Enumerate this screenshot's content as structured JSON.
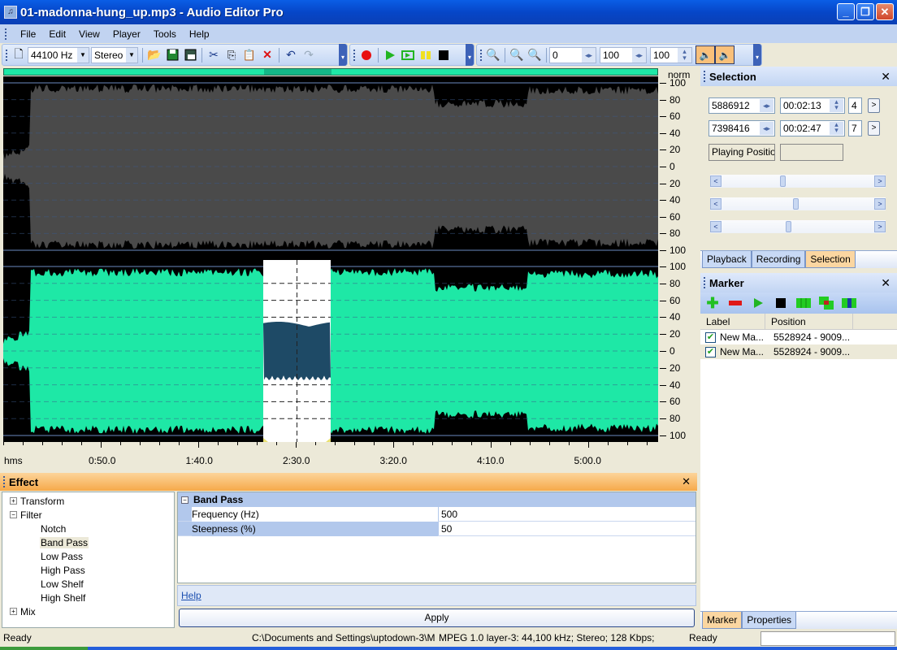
{
  "window": {
    "title": "01-madonna-hung_up.mp3 - Audio Editor Pro",
    "buttons": [
      "minimize",
      "restore",
      "close"
    ]
  },
  "menu": [
    "File",
    "Edit",
    "View",
    "Player",
    "Tools",
    "Help"
  ],
  "toolbar": {
    "sample_rate": "44100 Hz",
    "channels": "Stereo",
    "zoom_h": "0",
    "zoom_v": "100",
    "volume": "100",
    "icons": [
      "new-file-icon",
      "open-folder-icon",
      "save-icon",
      "save-as-icon",
      "cut-icon",
      "copy-icon",
      "paste-icon",
      "delete-icon",
      "undo-icon",
      "redo-icon",
      "record-icon",
      "play-icon",
      "play-loop-icon",
      "pause-icon",
      "stop-icon",
      "zoom-all-icon",
      "zoom-in-icon",
      "zoom-out-icon",
      "left-channel-icon",
      "right-channel-icon"
    ]
  },
  "waveform": {
    "scale_label": "norm",
    "scale_ticks": [
      "100",
      "80",
      "60",
      "40",
      "20",
      "0",
      "20",
      "40",
      "60",
      "80",
      "100"
    ],
    "time_unit": "hms",
    "time_ticks": [
      "0:50.0",
      "1:40.0",
      "2:30.0",
      "3:20.0",
      "4:10.0",
      "5:00.0"
    ],
    "selection_fraction": [
      0.397,
      0.5
    ],
    "colors": {
      "channel1": "#4a4a4a",
      "channel2": "#1ee8a6",
      "selected": "#1e4a66",
      "background": "#000000"
    }
  },
  "effect": {
    "title": "Effect",
    "tree": [
      {
        "label": "Transform",
        "type": "group",
        "expanded": false
      },
      {
        "label": "Filter",
        "type": "group",
        "expanded": true
      },
      {
        "label": "Notch",
        "type": "leaf"
      },
      {
        "label": "Band Pass",
        "type": "leaf",
        "selected": true
      },
      {
        "label": "Low Pass",
        "type": "leaf"
      },
      {
        "label": "High Pass",
        "type": "leaf"
      },
      {
        "label": "Low Shelf",
        "type": "leaf"
      },
      {
        "label": "High Shelf",
        "type": "leaf"
      },
      {
        "label": "Mix",
        "type": "group",
        "expanded": false
      }
    ],
    "properties": {
      "category": "Band Pass",
      "rows": [
        {
          "name": "Frequency (Hz)",
          "value": "500"
        },
        {
          "name": "Steepness (%)",
          "value": "50"
        }
      ]
    },
    "help_link": "Help",
    "apply_label": "Apply"
  },
  "selection_panel": {
    "title": "Selection",
    "start_sample": "5886912",
    "start_time": "00:02:13",
    "start_num": "4",
    "end_sample": "7398416",
    "end_time": "00:02:47",
    "end_num": "7",
    "playing_position_label": "Playing Positio",
    "playing_position_value": "",
    "sliders": [
      0.38,
      0.47,
      0.42
    ],
    "tabs": [
      "Playback",
      "Recording",
      "Selection"
    ],
    "active_tab": 2
  },
  "marker_panel": {
    "title": "Marker",
    "columns": [
      "Label",
      "Position"
    ],
    "rows": [
      {
        "checked": true,
        "label": "New Ma...",
        "position": "5528924 - 9009..."
      },
      {
        "checked": true,
        "label": "New Ma...",
        "position": "5528924 - 9009..."
      }
    ],
    "tabs": [
      "Marker",
      "Properties"
    ],
    "active_tab": 0
  },
  "status": {
    "left": "Ready",
    "path": "C:\\Documents and Settings\\uptodown-3\\M",
    "format": "MPEG 1.0 layer-3: 44,100 kHz; Stereo; 128 Kbps;",
    "state": "Ready"
  }
}
